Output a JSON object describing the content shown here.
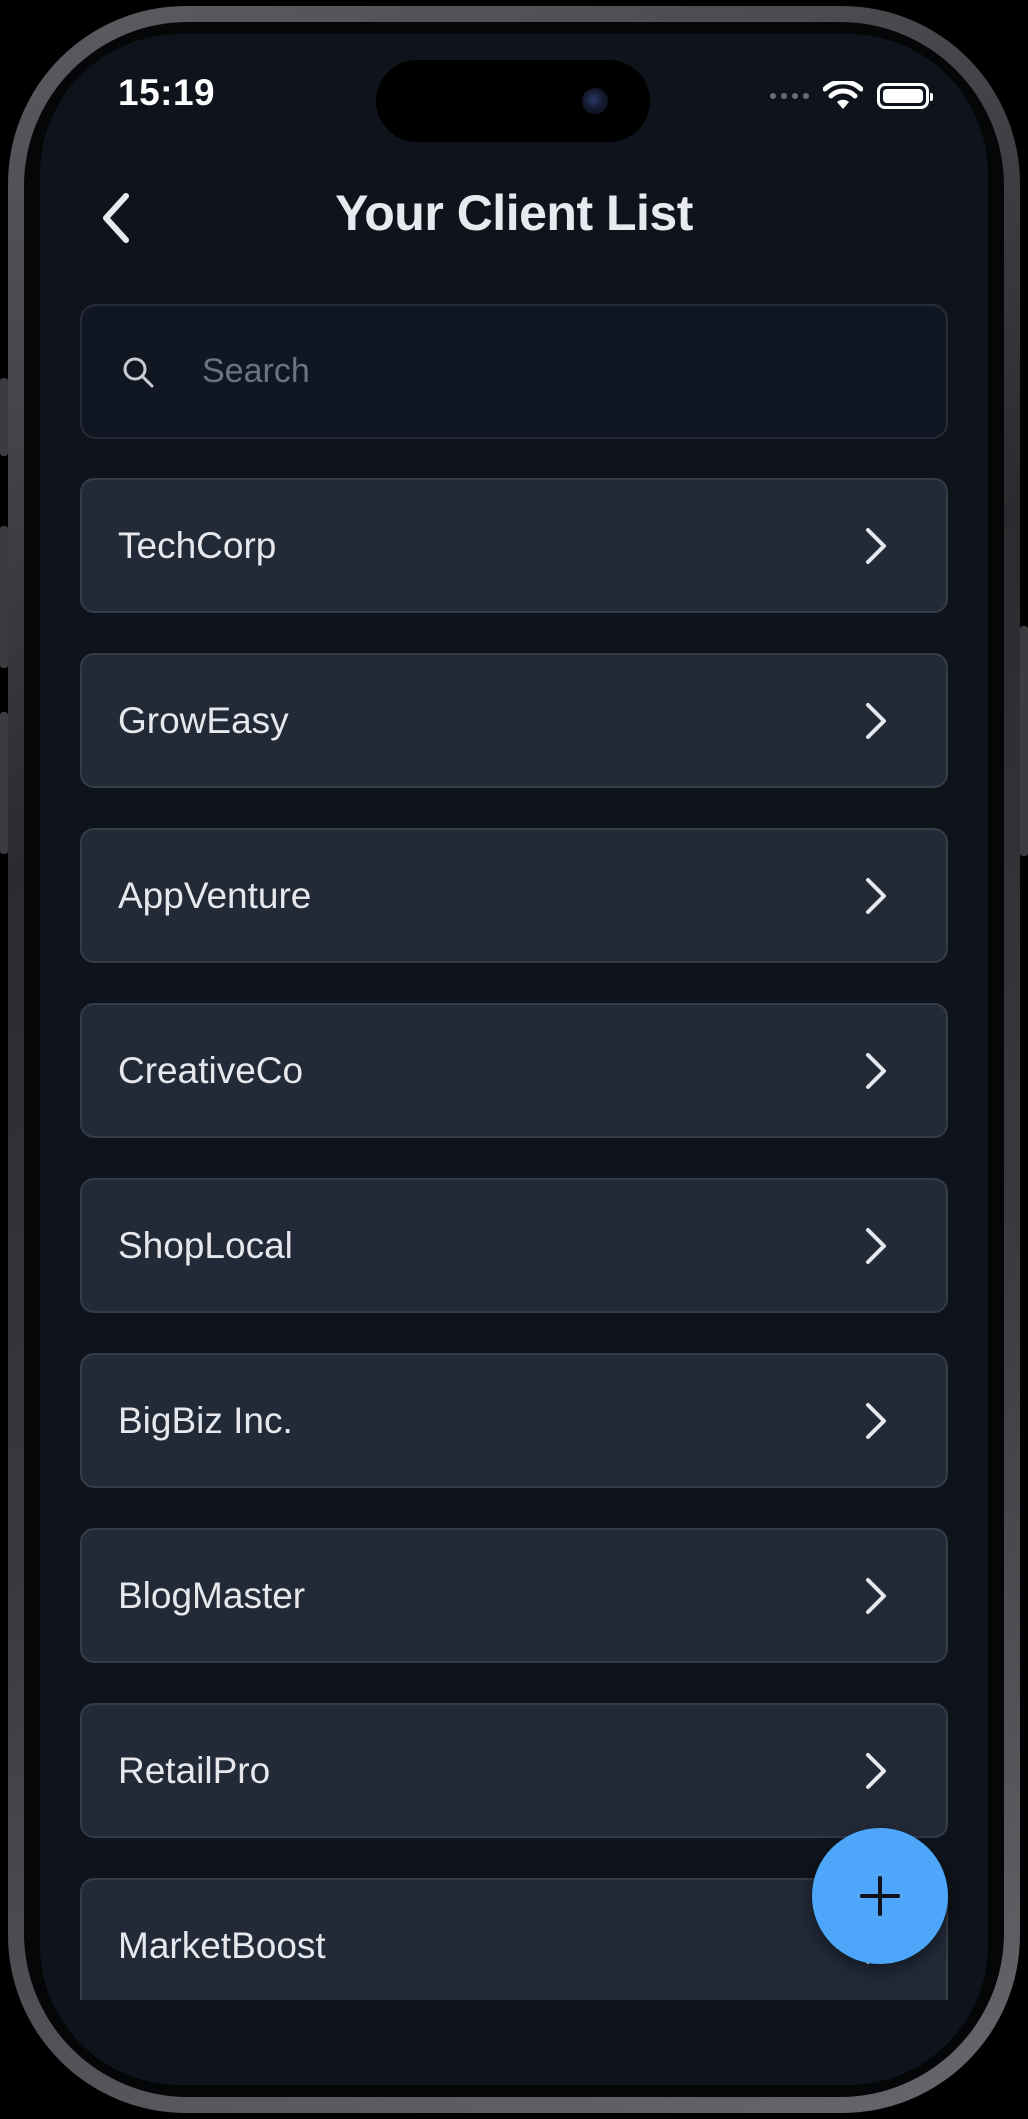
{
  "status_bar": {
    "time": "15:19"
  },
  "header": {
    "title": "Your Client List",
    "back_icon": "chevron-left-icon"
  },
  "search": {
    "placeholder": "Search",
    "value": "",
    "icon": "search-icon"
  },
  "clients": [
    {
      "name": "TechCorp"
    },
    {
      "name": "GrowEasy"
    },
    {
      "name": "AppVenture"
    },
    {
      "name": "CreativeCo"
    },
    {
      "name": "ShopLocal"
    },
    {
      "name": "BigBiz Inc."
    },
    {
      "name": "BlogMaster"
    },
    {
      "name": "RetailPro"
    },
    {
      "name": "MarketBoost"
    }
  ],
  "fab": {
    "icon": "plus-icon"
  },
  "colors": {
    "background": "#0f141c",
    "card": "#222a38",
    "card_border": "#343c4a",
    "accent": "#4ea6fa",
    "text": "#e6e8ee",
    "placeholder": "#6c7380"
  }
}
